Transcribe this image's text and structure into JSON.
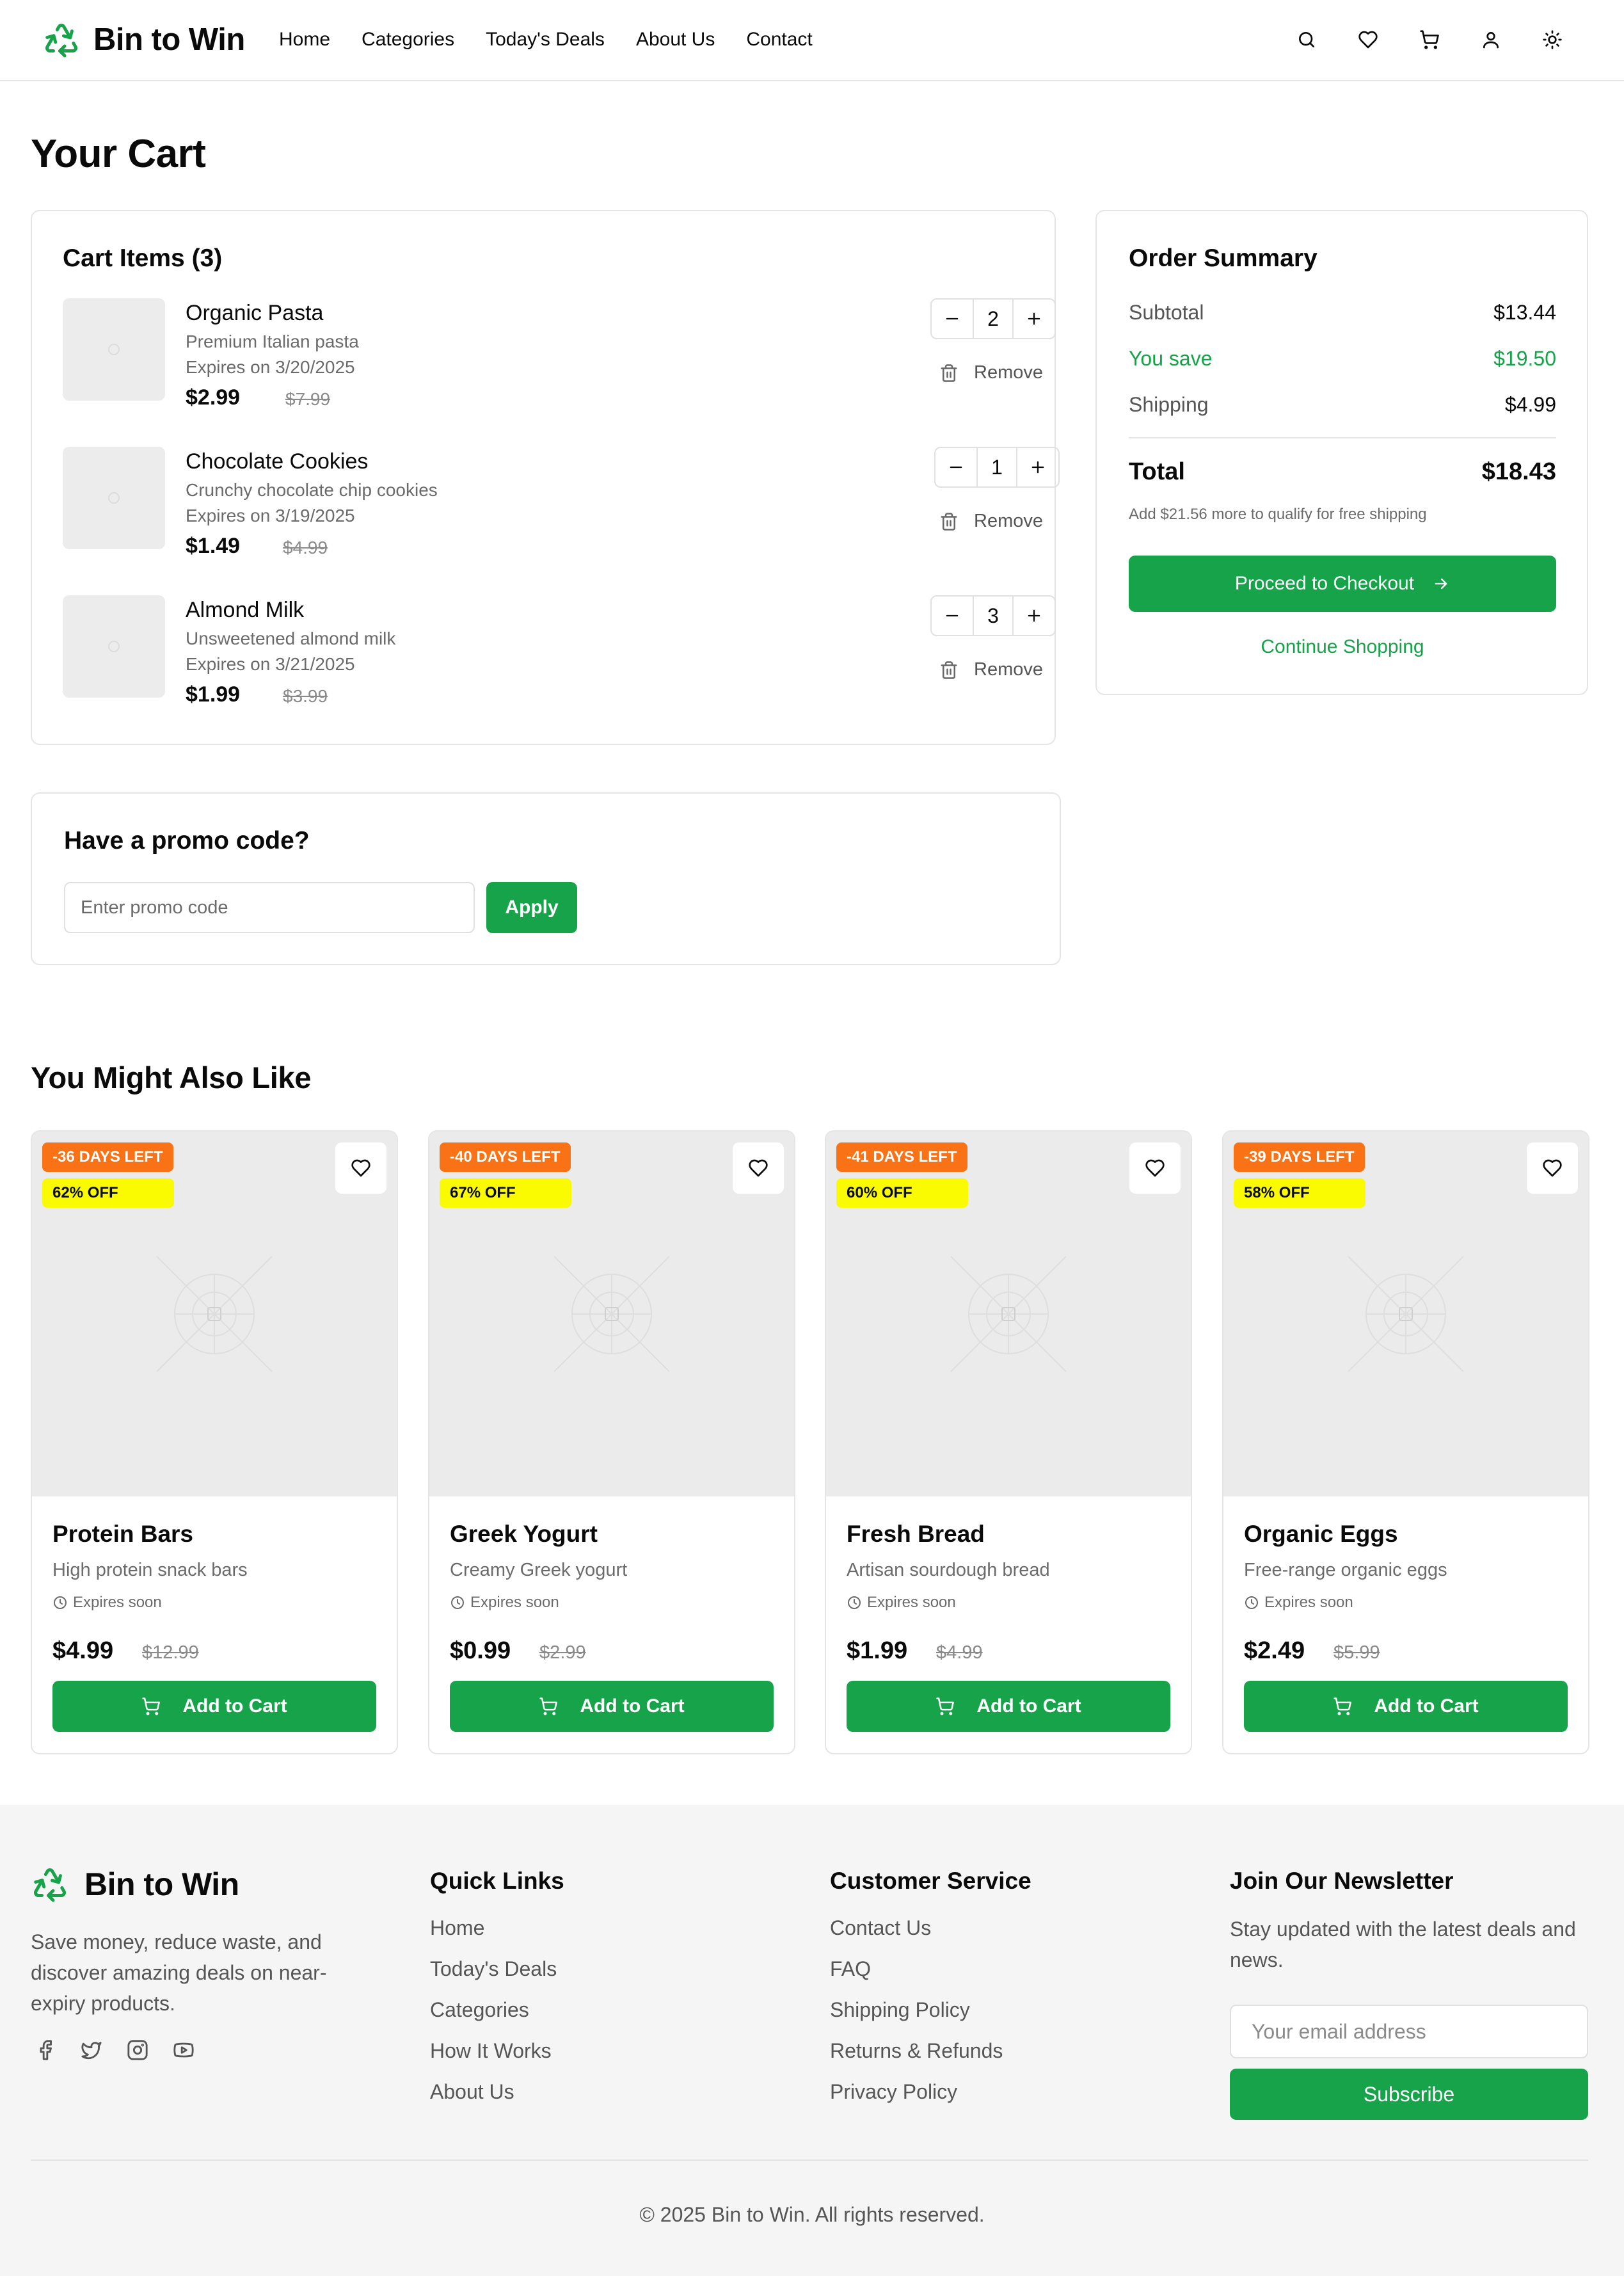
{
  "brand": {
    "name": "Bin to Win",
    "color": "#16a34a"
  },
  "nav": {
    "items": [
      "Home",
      "Categories",
      "Today's Deals",
      "About Us",
      "Contact"
    ]
  },
  "header_icons": [
    "search-icon",
    "heart-icon",
    "cart-icon",
    "user-icon",
    "sun-icon"
  ],
  "page": {
    "title": "Your Cart"
  },
  "cart": {
    "title": "Cart Items (3)",
    "remove_label": "Remove",
    "items": [
      {
        "name": "Organic Pasta",
        "description": "Premium Italian pasta",
        "expires": "Expires on 3/20/2025",
        "price": "$2.99",
        "old_price": "$7.99",
        "quantity": "2"
      },
      {
        "name": "Chocolate Cookies",
        "description": "Crunchy chocolate chip cookies",
        "expires": "Expires on 3/19/2025",
        "price": "$1.49",
        "old_price": "$4.99",
        "quantity": "1"
      },
      {
        "name": "Almond Milk",
        "description": "Unsweetened almond milk",
        "expires": "Expires on 3/21/2025",
        "price": "$1.99",
        "old_price": "$3.99",
        "quantity": "3"
      }
    ]
  },
  "summary": {
    "title": "Order Summary",
    "subtotal_label": "Subtotal",
    "subtotal": "$13.44",
    "save_label": "You save",
    "save": "$19.50",
    "shipping_label": "Shipping",
    "shipping": "$4.99",
    "total_label": "Total",
    "total": "$18.43",
    "note": "Add $21.56 more to qualify for free shipping",
    "checkout_label": "Proceed to Checkout",
    "continue_label": "Continue Shopping"
  },
  "promo": {
    "title": "Have a promo code?",
    "placeholder": "Enter promo code",
    "value": "",
    "apply_label": "Apply"
  },
  "recommendations": {
    "title": "You Might Also Like",
    "expires_label": "Expires soon",
    "add_label": "Add to Cart",
    "products": [
      {
        "days": "-36 DAYS LEFT",
        "off": "62% OFF",
        "name": "Protein Bars",
        "description": "High protein snack bars",
        "price": "$4.99",
        "old_price": "$12.99"
      },
      {
        "days": "-40 DAYS LEFT",
        "off": "67% OFF",
        "name": "Greek Yogurt",
        "description": "Creamy Greek yogurt",
        "price": "$0.99",
        "old_price": "$2.99"
      },
      {
        "days": "-41 DAYS LEFT",
        "off": "60% OFF",
        "name": "Fresh Bread",
        "description": "Artisan sourdough bread",
        "price": "$1.99",
        "old_price": "$4.99"
      },
      {
        "days": "-39 DAYS LEFT",
        "off": "58% OFF",
        "name": "Organic Eggs",
        "description": "Free-range organic eggs",
        "price": "$2.49",
        "old_price": "$5.99"
      }
    ]
  },
  "footer": {
    "about": "Save money, reduce waste, and discover amazing deals on near-expiry products.",
    "social": [
      "facebook-icon",
      "twitter-icon",
      "instagram-icon",
      "youtube-icon"
    ],
    "quick_links": {
      "title": "Quick Links",
      "links": [
        "Home",
        "Today's Deals",
        "Categories",
        "How It Works",
        "About Us"
      ]
    },
    "customer_service": {
      "title": "Customer Service",
      "links": [
        "Contact Us",
        "FAQ",
        "Shipping Policy",
        "Returns & Refunds",
        "Privacy Policy"
      ]
    },
    "newsletter": {
      "title": "Join Our Newsletter",
      "text": "Stay updated with the latest deals and news.",
      "placeholder": "Your email address",
      "button_label": "Subscribe"
    },
    "copyright": "© 2025 Bin to Win. All rights reserved."
  }
}
